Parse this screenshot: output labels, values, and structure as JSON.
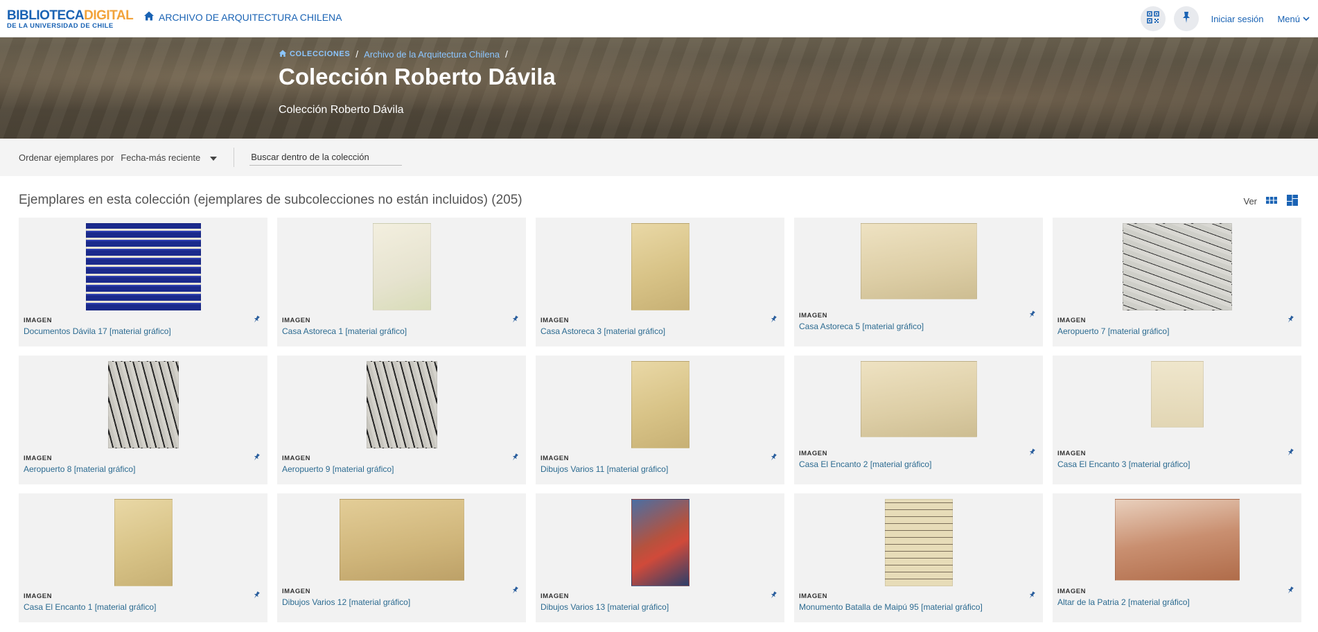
{
  "header": {
    "logo_line1_a": "BIBLIOTECA",
    "logo_line1_b": "DIGITAL",
    "logo_line2": "DE LA UNIVERSIDAD DE CHILE",
    "archive_link": "ARCHIVO DE ARQUITECTURA CHILENA",
    "login": "Iniciar sesión",
    "menu": "Menú"
  },
  "hero": {
    "breadcrumb_home": "COLECCIONES",
    "breadcrumb_item": "Archivo de la Arquitectura Chilena",
    "separator": "/",
    "title": "Colección Roberto Dávila",
    "subtitle": "Colección Roberto Dávila"
  },
  "toolbar": {
    "sort_label": "Ordenar ejemplares por",
    "sort_value": "Fecha-más reciente",
    "search_placeholder": "Buscar dentro de la colección"
  },
  "results": {
    "heading": "Ejemplares en esta colección (ejemplares de subcolecciones no están incluidos) (205)",
    "view_label": "Ver"
  },
  "items": [
    {
      "type": "IMAGEN",
      "title": "Documentos Dávila 17 [material gráfico]",
      "thumb": "poster"
    },
    {
      "type": "IMAGEN",
      "title": "Casa Astoreca 1 [material gráfico]",
      "thumb": "sketch-tall"
    },
    {
      "type": "IMAGEN",
      "title": "Casa Astoreca 3 [material gráfico]",
      "thumb": "sketch-tall-y"
    },
    {
      "type": "IMAGEN",
      "title": "Casa Astoreca 5 [material gráfico]",
      "thumb": "sketch-wide"
    },
    {
      "type": "IMAGEN",
      "title": "Aeropuerto 7 [material gráfico]",
      "thumb": "ink-wide"
    },
    {
      "type": "IMAGEN",
      "title": "Aeropuerto 8 [material gráfico]",
      "thumb": "ink-tall"
    },
    {
      "type": "IMAGEN",
      "title": "Aeropuerto 9 [material gráfico]",
      "thumb": "ink-tall"
    },
    {
      "type": "IMAGEN",
      "title": "Dibujos Varios 11 [material gráfico]",
      "thumb": "sketch-tall-y"
    },
    {
      "type": "IMAGEN",
      "title": "Casa El Encanto 2 [material gráfico]",
      "thumb": "sketch-wide"
    },
    {
      "type": "IMAGEN",
      "title": "Casa El Encanto 3 [material gráfico]",
      "thumb": "plan-small"
    },
    {
      "type": "IMAGEN",
      "title": "Casa El Encanto 1 [material gráfico]",
      "thumb": "sketch-tall-y"
    },
    {
      "type": "IMAGEN",
      "title": "Dibujos Varios 12 [material gráfico]",
      "thumb": "sketch-wide-y"
    },
    {
      "type": "IMAGEN",
      "title": "Dibujos Varios 13 [material gráfico]",
      "thumb": "color-tall"
    },
    {
      "type": "IMAGEN",
      "title": "Monumento Batalla de Maipú 95 [material gráfico]",
      "thumb": "list-tall"
    },
    {
      "type": "IMAGEN",
      "title": "Altar de la Patria 2 [material gráfico]",
      "thumb": "sepia-wide"
    }
  ]
}
